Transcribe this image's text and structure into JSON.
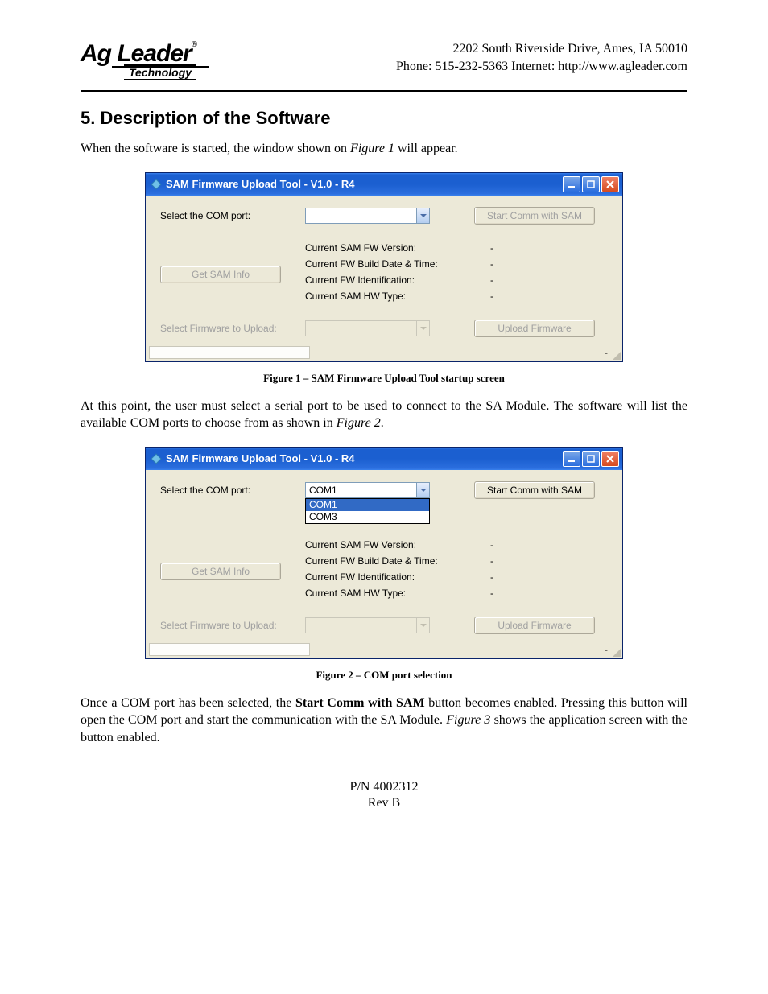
{
  "header": {
    "logo_main": "Ag Leader",
    "logo_sub": "Technology",
    "address": "2202 South Riverside Drive, Ames, IA  50010",
    "contact": "Phone: 515-232-5363 Internet:  http://www.agleader.com"
  },
  "section": {
    "title": "5. Description of the Software",
    "para1_a": "When the software is started, the window shown on ",
    "para1_fig": "Figure 1",
    "para1_b": " will appear.",
    "para2_a": "At this point, the user must select a serial port to be used to connect to the SA Module. The software will list the available COM ports to choose from as shown in ",
    "para2_fig": "Figure 2",
    "para2_b": ".",
    "para3_a": "Once a COM port has been selected, the ",
    "para3_bold": "Start Comm with SAM",
    "para3_b": " button becomes enabled. Pressing this button will open the COM port and start the communication with the SA Module. ",
    "para3_fig": "Figure 3",
    "para3_c": " shows the application screen with the button enabled."
  },
  "figure1": {
    "caption": "Figure 1 – SAM Firmware Upload Tool startup screen",
    "title": "SAM Firmware Upload Tool - V1.0 - R4",
    "select_com_label": "Select the COM port:",
    "com_value": "",
    "start_comm_btn": "Start Comm with SAM",
    "get_sam_btn": "Get SAM Info",
    "info": {
      "fw_version_label": "Current SAM FW Version:",
      "fw_version_val": "-",
      "build_date_label": "Current FW Build Date & Time:",
      "build_date_val": "-",
      "fw_id_label": "Current FW Identification:",
      "fw_id_val": "-",
      "hw_type_label": "Current SAM HW Type:",
      "hw_type_val": "-"
    },
    "select_fw_label": "Select Firmware to Upload:",
    "upload_btn": "Upload Firmware",
    "status_text": "-"
  },
  "figure2": {
    "caption": "Figure 2 – COM port selection",
    "title": "SAM Firmware Upload Tool - V1.0 - R4",
    "select_com_label": "Select the COM port:",
    "com_value": "COM1",
    "com_options": [
      "COM1",
      "COM3"
    ],
    "start_comm_btn": "Start Comm with SAM",
    "get_sam_btn": "Get SAM Info",
    "info": {
      "fw_version_label": "Current SAM FW Version:",
      "fw_version_val": "-",
      "build_date_label": "Current FW Build Date & Time:",
      "build_date_val": "-",
      "fw_id_label": "Current FW Identification:",
      "fw_id_val": "-",
      "hw_type_label": "Current SAM HW Type:",
      "hw_type_val": "-"
    },
    "select_fw_label": "Select Firmware to Upload:",
    "upload_btn": "Upload Firmware",
    "status_text": "-"
  },
  "footer": {
    "pn": "P/N 4002312",
    "rev": "Rev B"
  }
}
